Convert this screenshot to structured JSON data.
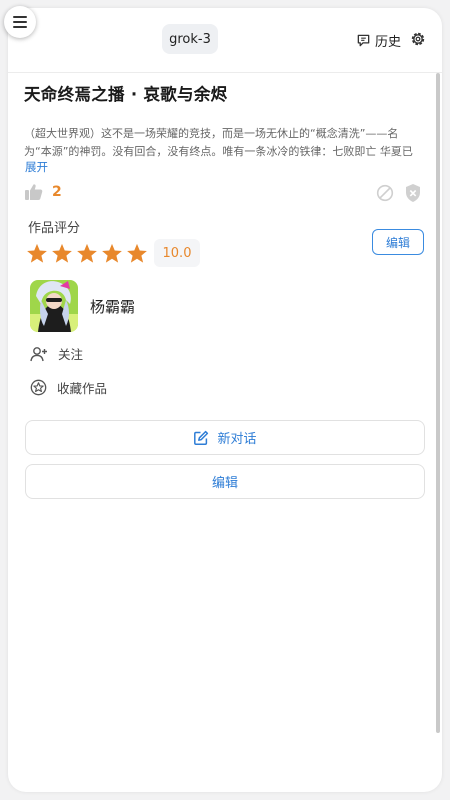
{
  "header": {
    "model": "grok-3",
    "history_label": "历史"
  },
  "work": {
    "title": "天命终焉之播 · 哀歌与余烬",
    "description": "（超大世界观）这不是一场荣耀的竞技，而是一场无休止的“概念清洗”——名为“本源”的神罚。没有回合，没有终点。唯有一条冰冷的铁律：七败即亡 华夏已负四场，文明濒临抹杀 伤痕累累的英灵 为遗忘他们的故...",
    "expand_label": "展开",
    "likes": "2",
    "rating_label": "作品评分",
    "rating": 5,
    "score": "10.0",
    "edit_label": "编辑"
  },
  "author": {
    "name": "杨霸霸"
  },
  "actions": {
    "follow": "关注",
    "collect": "收藏作品"
  },
  "buttons": {
    "new_chat": "新对话",
    "edit": "编辑"
  },
  "colors": {
    "accent": "#2e7dd6",
    "star": "#e8882c"
  }
}
